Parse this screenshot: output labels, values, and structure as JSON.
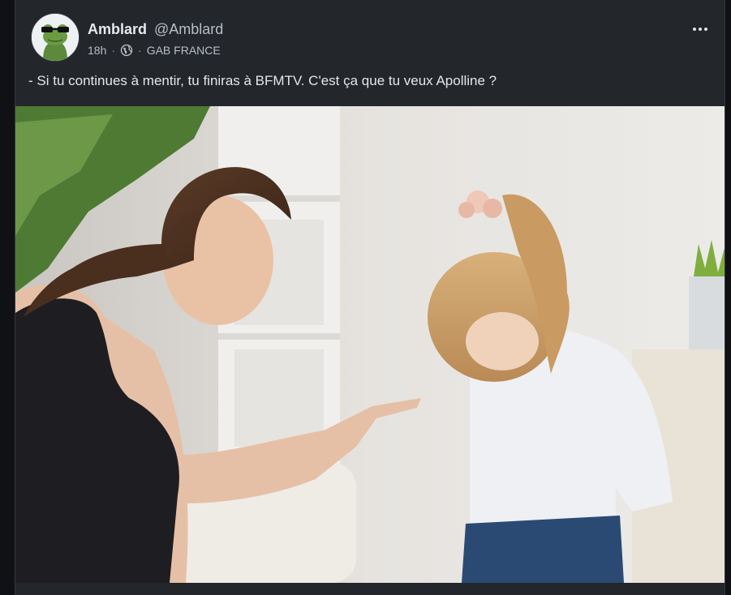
{
  "post": {
    "author": {
      "display_name": "Amblard",
      "handle": "@Amblard",
      "avatar_icon": "frog-with-sunglasses-avatar"
    },
    "time": "18h",
    "separator": "·",
    "visibility_icon": "globe-icon",
    "group": "GAB FRANCE",
    "more_icon": "more-options-icon",
    "text": "- Si tu continues à mentir, tu finiras à BFMTV. C'est ça que tu veux Apolline ?",
    "image_description_icon": "photo"
  },
  "colors": {
    "card_bg": "#23262b",
    "page_bg": "#0f1114",
    "text": "#e3e6ea",
    "muted": "#b8bec6"
  }
}
